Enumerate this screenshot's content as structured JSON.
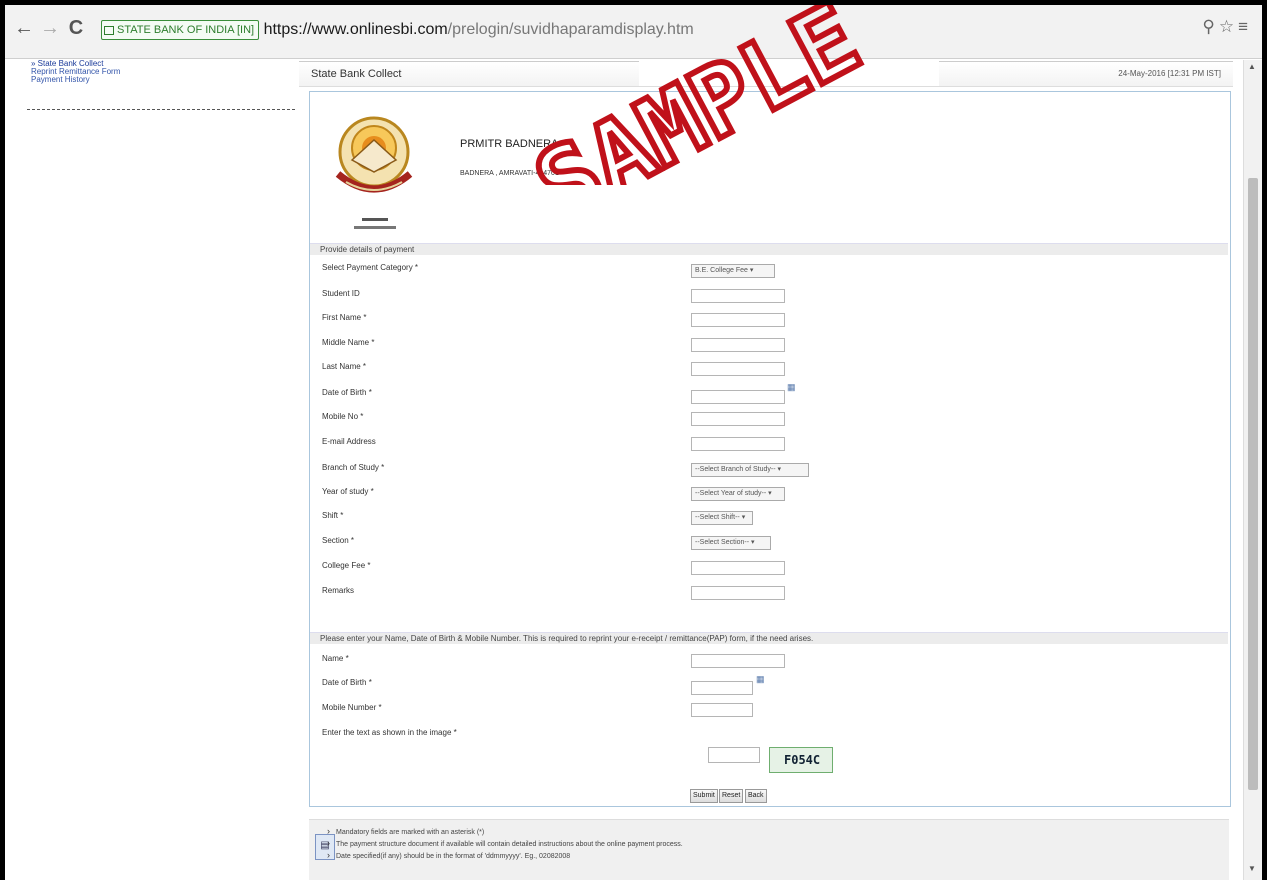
{
  "browser": {
    "security_badge": "STATE BANK OF INDIA [IN]",
    "url_protocol": "https://",
    "url_host": "www.onlinesbi.com",
    "url_path": "/prelogin/suvidhaparamdisplay.htm"
  },
  "sidebar": {
    "items": [
      {
        "label": "» State Bank Collect"
      },
      {
        "label": "Reprint Remittance Form"
      },
      {
        "label": "Payment History"
      }
    ]
  },
  "header": {
    "title": "State Bank Collect",
    "datetime": "24-May-2016 [12:31 PM IST]"
  },
  "institution": {
    "name": "PRMITR BADNERA",
    "address": "BADNERA , AMRAVATI-444701"
  },
  "form": {
    "section1_heading": "Provide details of payment",
    "fields": {
      "payment_category": {
        "label": "Select Payment Category *",
        "value": "B.E. College Fee"
      },
      "student_id": {
        "label": "Student ID"
      },
      "first_name": {
        "label": "First Name *"
      },
      "middle_name": {
        "label": "Middle Name *"
      },
      "last_name": {
        "label": "Last Name *"
      },
      "dob": {
        "label": "Date of Birth *"
      },
      "mobile": {
        "label": "Mobile No *"
      },
      "email": {
        "label": "E-mail Address"
      },
      "branch": {
        "label": "Branch of Study *",
        "value": "--Select Branch of Study--"
      },
      "year": {
        "label": "Year of study *",
        "value": "--Select Year of study--"
      },
      "shift": {
        "label": "Shift *",
        "value": "--Select Shift--"
      },
      "section": {
        "label": "Section *",
        "value": "--Select Section--"
      },
      "college_fee": {
        "label": "College Fee *"
      },
      "remarks": {
        "label": "Remarks"
      }
    },
    "section2_heading": "Please enter your Name, Date of Birth & Mobile Number. This is required to reprint your e-receipt / remittance(PAP) form, if the need arises.",
    "reprint": {
      "name": {
        "label": "Name *"
      },
      "dob": {
        "label": "Date of Birth *"
      },
      "mobile": {
        "label": "Mobile Number *"
      },
      "captcha_label": "Enter the text as shown in the image *",
      "captcha_text": "F054C"
    },
    "buttons": {
      "submit": "Submit",
      "reset": "Reset",
      "back": "Back"
    }
  },
  "notes": [
    "Mandatory fields are marked with an asterisk (*)",
    "The payment structure document if available will contain detailed instructions about the online payment process.",
    "Date specified(if any) should be in the format of 'ddmmyyyy'. Eg., 02082008"
  ],
  "watermark": {
    "text": "SAMPLE",
    "color": "#c0111a"
  }
}
